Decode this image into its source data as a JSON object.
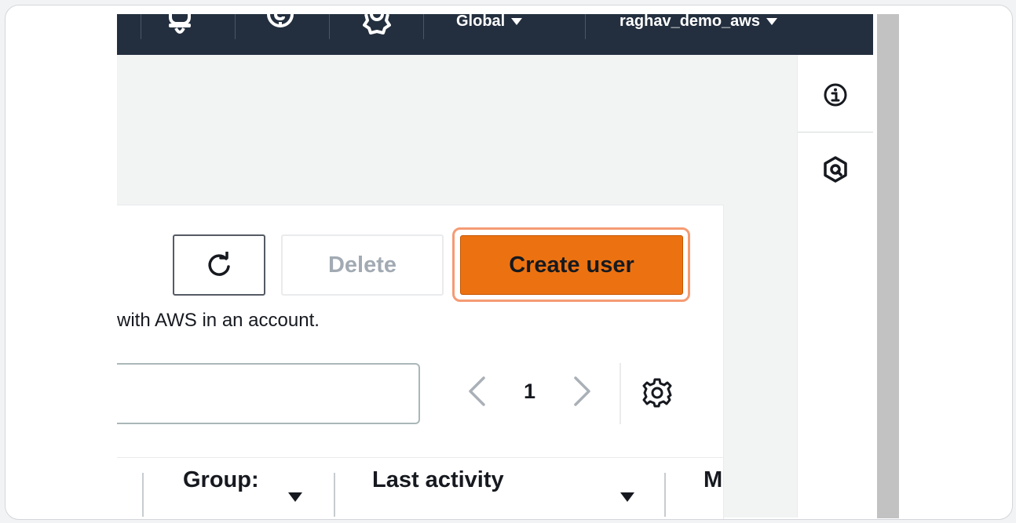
{
  "topnav": {
    "region": "Global",
    "account": "raghav_demo_aws",
    "icons": [
      "bell-icon",
      "help-icon",
      "settings-icon"
    ]
  },
  "toolbar": {
    "refresh_icon": "refresh-icon",
    "delete_label": "Delete",
    "create_label": "Create user"
  },
  "description": "with AWS in an account.",
  "search": {
    "value": "",
    "placeholder": ""
  },
  "pagination": {
    "current_page": "1"
  },
  "table": {
    "columns": [
      "Group:",
      "Last activity",
      "M"
    ]
  },
  "side_rail": {
    "icons": [
      "info-icon",
      "cloudshell-icon"
    ]
  },
  "colors": {
    "accent": "#ec7211",
    "navbar": "#232f3e",
    "highlight": "#f59b73"
  }
}
